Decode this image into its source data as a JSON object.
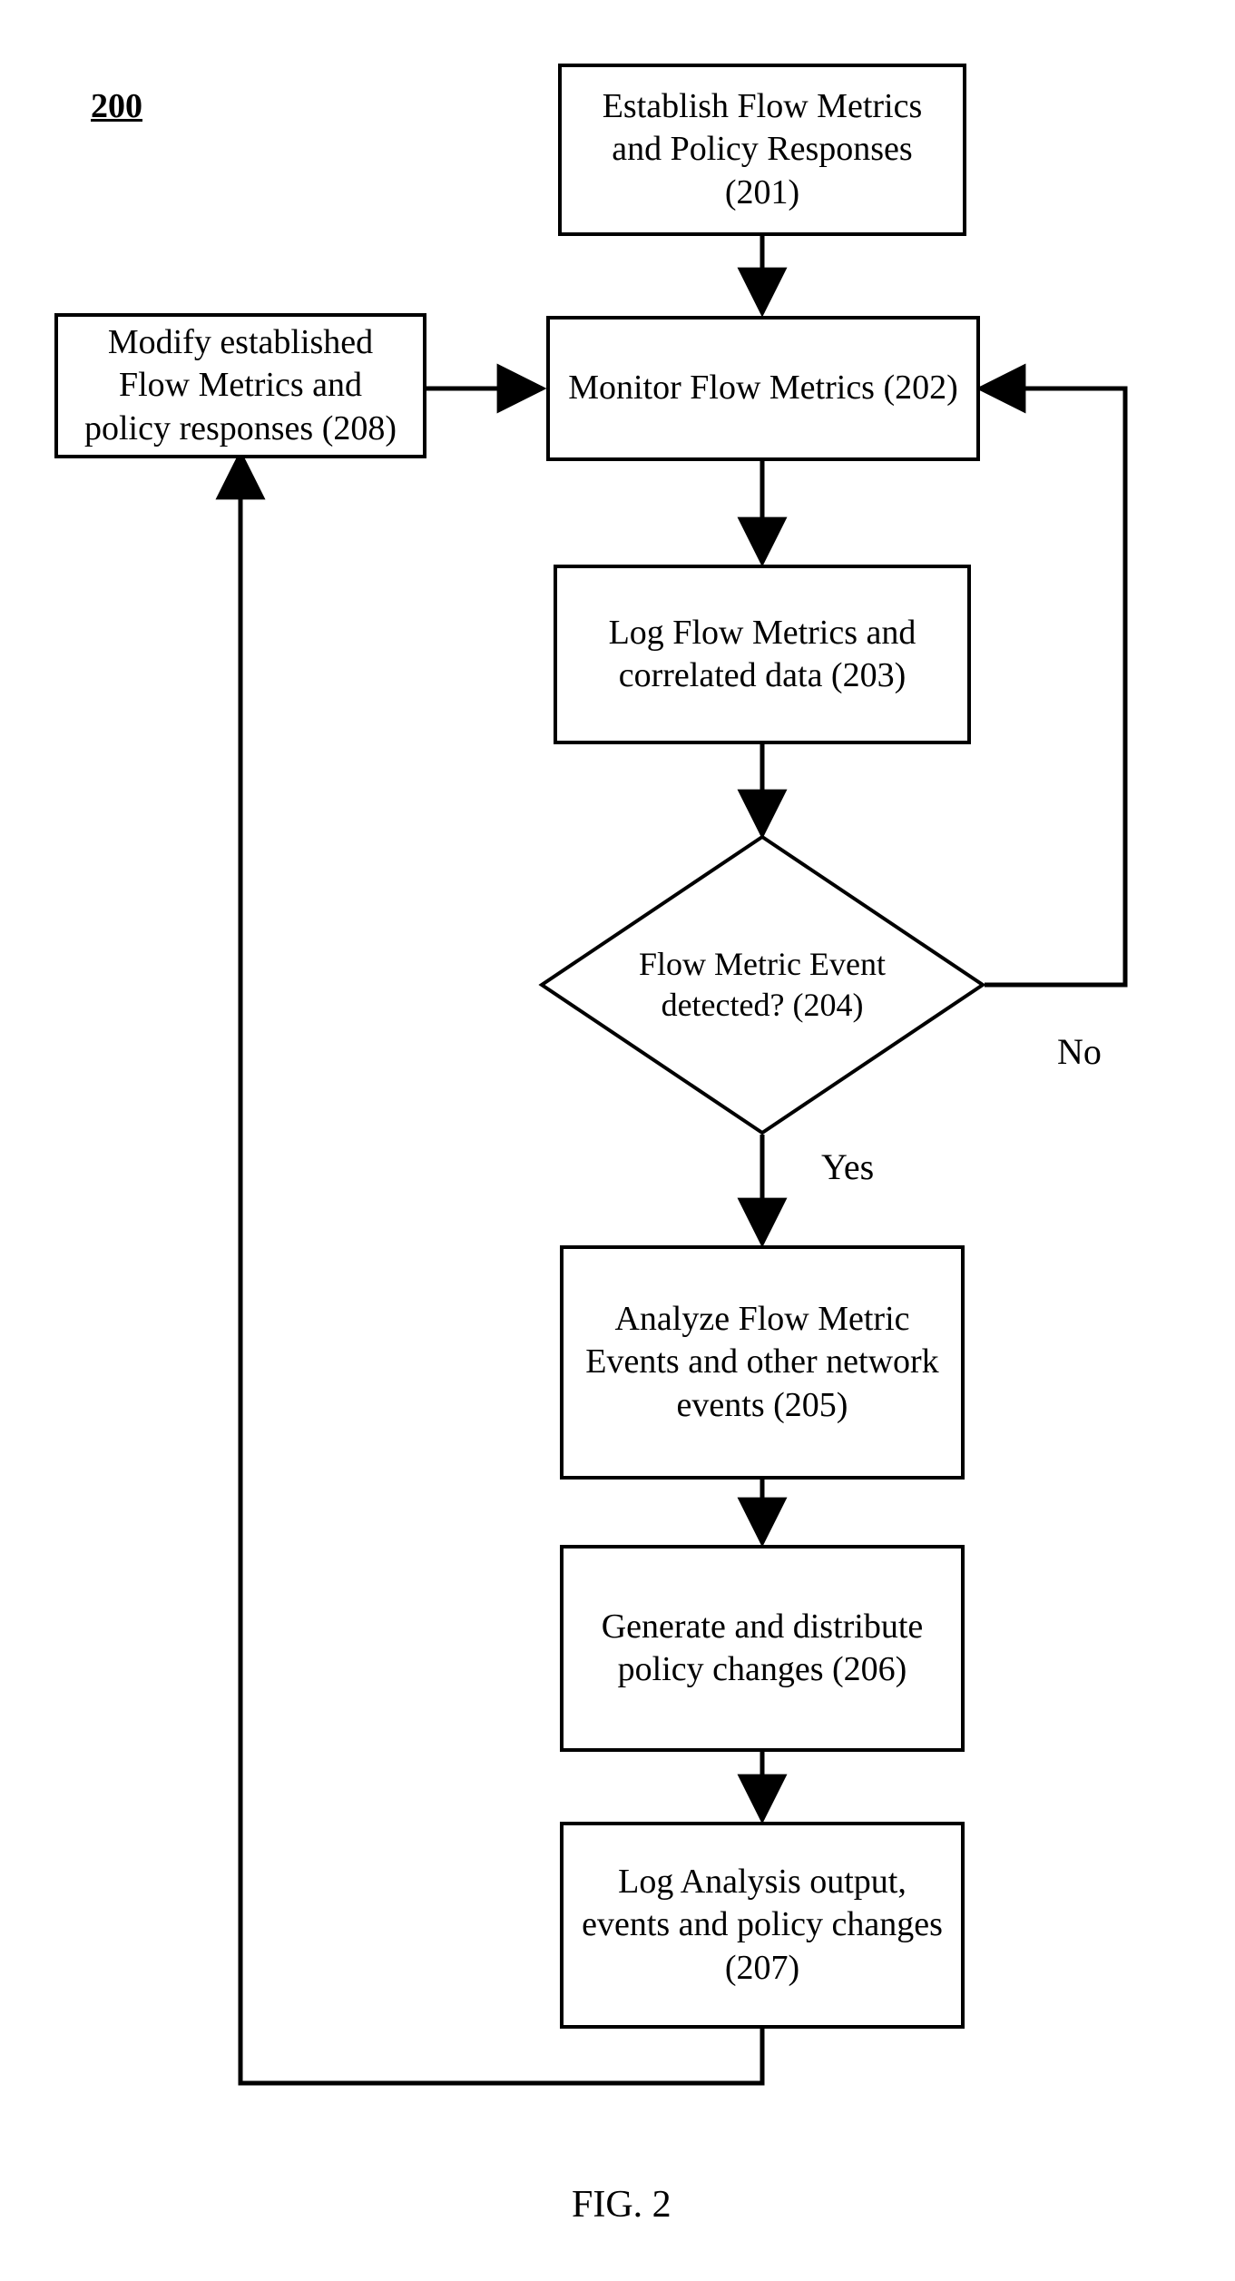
{
  "figure_label": "200",
  "caption": "FIG. 2",
  "nodes": {
    "n201": {
      "text": "Establish Flow Metrics and Policy Responses (201)"
    },
    "n202": {
      "text": "Monitor Flow Metrics (202)"
    },
    "n203": {
      "text": "Log Flow Metrics and correlated data (203)"
    },
    "n204": {
      "text": "Flow Metric Event detected? (204)"
    },
    "n205": {
      "text": "Analyze Flow Metric Events and other network events (205)"
    },
    "n206": {
      "text": "Generate and distribute policy changes (206)"
    },
    "n207": {
      "text": "Log Analysis output, events and policy changes (207)"
    },
    "n208": {
      "text": "Modify established Flow Metrics and policy responses (208)"
    }
  },
  "edge_labels": {
    "yes": "Yes",
    "no": "No"
  },
  "chart_data": {
    "type": "flowchart",
    "title": "200",
    "caption": "FIG. 2",
    "nodes": [
      {
        "id": "201",
        "shape": "process",
        "text": "Establish Flow Metrics and Policy Responses (201)"
      },
      {
        "id": "202",
        "shape": "process",
        "text": "Monitor Flow Metrics (202)"
      },
      {
        "id": "203",
        "shape": "process",
        "text": "Log Flow Metrics and correlated data (203)"
      },
      {
        "id": "204",
        "shape": "decision",
        "text": "Flow Metric Event detected? (204)"
      },
      {
        "id": "205",
        "shape": "process",
        "text": "Analyze Flow Metric Events and other network events (205)"
      },
      {
        "id": "206",
        "shape": "process",
        "text": "Generate and distribute policy changes (206)"
      },
      {
        "id": "207",
        "shape": "process",
        "text": "Log Analysis output, events and policy changes (207)"
      },
      {
        "id": "208",
        "shape": "process",
        "text": "Modify established Flow Metrics and policy responses (208)"
      }
    ],
    "edges": [
      {
        "from": "201",
        "to": "202",
        "label": ""
      },
      {
        "from": "202",
        "to": "203",
        "label": ""
      },
      {
        "from": "203",
        "to": "204",
        "label": ""
      },
      {
        "from": "204",
        "to": "205",
        "label": "Yes"
      },
      {
        "from": "204",
        "to": "202",
        "label": "No"
      },
      {
        "from": "205",
        "to": "206",
        "label": ""
      },
      {
        "from": "206",
        "to": "207",
        "label": ""
      },
      {
        "from": "207",
        "to": "208",
        "label": ""
      },
      {
        "from": "208",
        "to": "202",
        "label": ""
      }
    ]
  }
}
